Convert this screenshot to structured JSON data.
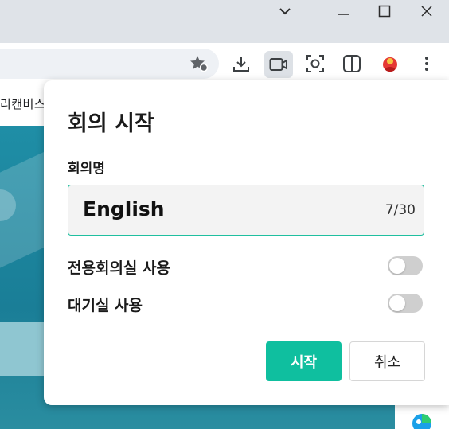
{
  "window": {
    "buttons": [
      "tab-search",
      "minimize",
      "maximize",
      "close"
    ]
  },
  "toolbar": {
    "icons": [
      "bookmark-star-icon",
      "download-icon",
      "video-record-icon",
      "screenshot-icon",
      "split-view-icon",
      "profile-avatar-icon",
      "more-menu-icon"
    ]
  },
  "bookmarks": {
    "visible_text": "리캔버스"
  },
  "dialog": {
    "title": "회의 시작",
    "name_label": "회의명",
    "name_value": "English",
    "char_count": "7/30",
    "options": [
      {
        "label": "전용회의실 사용",
        "enabled": false
      },
      {
        "label": "대기실 사용",
        "enabled": false
      }
    ],
    "start_label": "시작",
    "cancel_label": "취소"
  },
  "colors": {
    "accent": "#0fbf9f",
    "titlebar": "#dfe3e8",
    "page": "#1f8ea6"
  }
}
